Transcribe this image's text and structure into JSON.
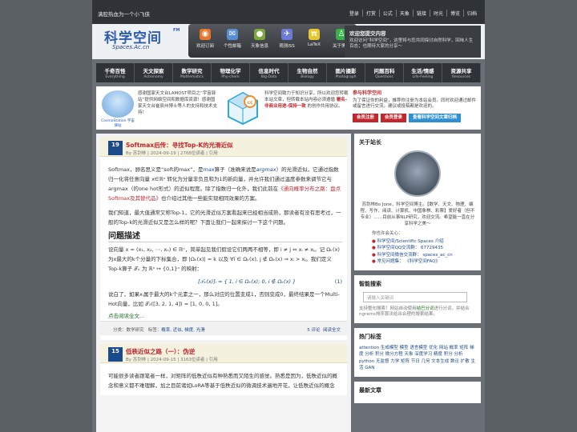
{
  "topbar": {
    "slogan": "满腔热血为一个小飞侠",
    "links": [
      "登录",
      "打赏",
      "公式",
      "天象",
      "链接",
      "时光",
      "博览",
      "归档"
    ]
  },
  "logo": {
    "text": "科学空间",
    "tm": "FM",
    "sub": "Spaces.Ac.cn"
  },
  "iconbar": [
    {
      "label": "欢迎订阅",
      "icon": "rss-icon",
      "glyph": "◉",
      "color": "#e8772e"
    },
    {
      "label": "个性邮箱",
      "icon": "mail-icon",
      "glyph": "✉",
      "color": "#5a8fd2"
    },
    {
      "label": "天象信息",
      "icon": "planet-icon",
      "glyph": "●",
      "color": "#7aa83a"
    },
    {
      "label": "观测ISS",
      "icon": "satellite-icon",
      "glyph": "✈",
      "color": "#6b7bd6"
    },
    {
      "label": "LaTeX",
      "icon": "pi-icon",
      "glyph": "π",
      "color": "#e8c72e"
    },
    {
      "label": "关于博主",
      "icon": "person-icon",
      "glyph": "♙",
      "color": "#38b14a"
    }
  ],
  "subscribe": {
    "title": "欢迎您提交内容",
    "desc": "欢迎访问“科学空间”，这里将与您共同探讨自然科学，回味人生百态；也期待大家的分享～"
  },
  "nav": [
    {
      "zh": "千奇百怪",
      "en": "Everything"
    },
    {
      "zh": "天文探索",
      "en": "Astronomy"
    },
    {
      "zh": "数学研究",
      "en": "Mathematics"
    },
    {
      "zh": "物理化学",
      "en": "Phy-chem"
    },
    {
      "zh": "信息时代",
      "en": "Big-Data"
    },
    {
      "zh": "生物自然",
      "en": "Biology"
    },
    {
      "zh": "图片摄影",
      "en": "Photograph"
    },
    {
      "zh": "问题百科",
      "en": "Questions"
    },
    {
      "zh": "生活/情感",
      "en": "Life-Feeling"
    },
    {
      "zh": "资源共享",
      "en": "Resources"
    }
  ],
  "notices": {
    "lamost": {
      "img_label": "CosmoStation 宇宙驿站",
      "text": "感谢国家天文台LAMOST项目之“宇宙驿站”提供网络空间和数据库资源！感谢国家天文台崔辰州博士等人的支持和技术支持！"
    },
    "cc": {
      "pre": "科学空间致力于知识分享，所以欢迎您转载本站文章，但转载本站内容必须遵循 ",
      "license": "署名-非商业用途-保持一致",
      "post": " 的创作共用协议。"
    },
    "join": {
      "title": "参与科学空间",
      "text": "为了保证你的利益，推荐你注册为本站会员。同时欢迎通过邮件或留言进行交流，建议或投稿都是欢迎的。",
      "buttons": [
        {
          "label": "会员注册",
          "color": "#c1272d"
        },
        {
          "label": "会员登录",
          "color": "#c1272d"
        },
        {
          "label": "查看科学空间文章归档",
          "color": "#2f8fd1"
        }
      ]
    }
  },
  "posts": [
    {
      "day": "19",
      "month": "Sep",
      "title": "Softmax后传：寻找Top-K的光滑近似",
      "meta": "By 苏剑林 | 2024-09-19 | 2768位读者 | 引用",
      "p1_pre": "Softmax，顾名思义是“soft的max”，是",
      "p1_math1": "max",
      "p1_mid": "算子（准确来说是",
      "p1_math2": "argmax",
      "p1_rest": "）的光滑近似，它通过指数归一化将任意向量 x∈ℝⁿ 转化为分量非负且和为1的新向量，并允许我们通过温度参数来调节它与argmax（的one hot形式）的近似程度。除了指数归一化外，我们此前在",
      "p1_link": "《通向概率分布之路：盘点Softmax及其替代品》",
      "p1_tail": "也介绍过其他一些能实现相同效果的方案。",
      "p2": "我们知道，最大值通常又称Top-1，它的光滑近似方案看起来已经相当成熟，那读者有没有思考过，一般的Top-k的光滑近似又是怎么样的呢？下面让我们一起来探讨一下这个问题。",
      "h2": "问题描述",
      "p3": "设向量 x = (x₁, x₂, ⋯, xₙ) ∈ ℝⁿ，简单起见我们假设它们两两不相等，即 i ≠ j ⇔ xᵢ ≠ xⱼ。记 Ωₖ(x) 为x最大的k个分量的下标集合，即 |Ωₖ(x)| = k 以及 ∀i ∈ Ωₖ(x), j ∉ Ωₖ(x) ⇒ xᵢ > xⱼ。我们定义Top-k算子 𝒯ₖ 为 ℝⁿ ↦ {0,1}ⁿ 的映射：",
      "formula": "[𝒯ₖ(x)]ᵢ = { 1, i ∈ Ωₖ(x);  0, i ∉ Ωₖ(x) }",
      "formula_no": "(1)",
      "p4": "说白了，如果xᵢ属于最大的k个元素之一，那么对应的位置变成1，否则变成0，最终结果是一个Multi-Hot向量，比如 𝒯₂([3, 2, 1, 4]) = [1, 0, 0, 1]。",
      "readmore": "点击阅读全文...",
      "cat_label": "分类：数学研究",
      "tags_label": "标签：",
      "tags": "概率, 近似, 梯度, 光滑",
      "comments": "5 评论",
      "read": "阅读全文"
    },
    {
      "day": "15",
      "month": "Sep",
      "title": "低秩近似之路（一）：伪逆",
      "meta": "By 苏剑林 | 2024-09-15 | 3163位读者 | 引用",
      "p1": "可能很多读者跟笔者一样，对矩阵的低秩近似有种熟悉而又陌生的感觉。熟悉是因为，低秩近似的概念和意义都不难理解，加之目前诸如LoRA等基于低秩近似的微调技术遍地开花，让低秩近似的概念"
    }
  ],
  "sidebar": {
    "about": {
      "title": "关于站长",
      "bio": "苏剑林Bo Jone，科学空间博主。【数学、天文、物理、编程、写作、阅读、计算机、中国象棋、彩票】爱好者（但不专业）……目前从事NLP研究，欢迎交流。希望能一直在分享科学之美～",
      "links_title": "你也许会关心：",
      "links": [
        {
          "k": "科学空间/Scientific Spaces",
          "v": "介绍"
        },
        {
          "k": "科学空间QQ交流群：",
          "v": "67729435"
        },
        {
          "k": "科学空间微信交流群：",
          "v": "spaces_ac_cn"
        },
        {
          "k": "常见问题集：",
          "v": "《科学空间FAQ》"
        }
      ]
    },
    "search": {
      "title": "智能搜索",
      "placeholder": "请输入关键词",
      "note_pre": "支持整句搜索！网站自动使用",
      "note_link": "结巴分词",
      "note_post": "进行分词，并结合ngrams排序算法给出合理的搜索结果。"
    },
    "tags": {
      "title": "热门标签",
      "text": "attention 生成模型 模型 语言模型 优化 网站 概率 矩阵 梯度 分析 积分 微分方程 天象 深度学习 精度 积分 分析 python 无监督 力学 矩阵 节日 几何 文本生成 数论 扩散 生活 GAN"
    },
    "latest": {
      "title": "最新文章"
    }
  }
}
